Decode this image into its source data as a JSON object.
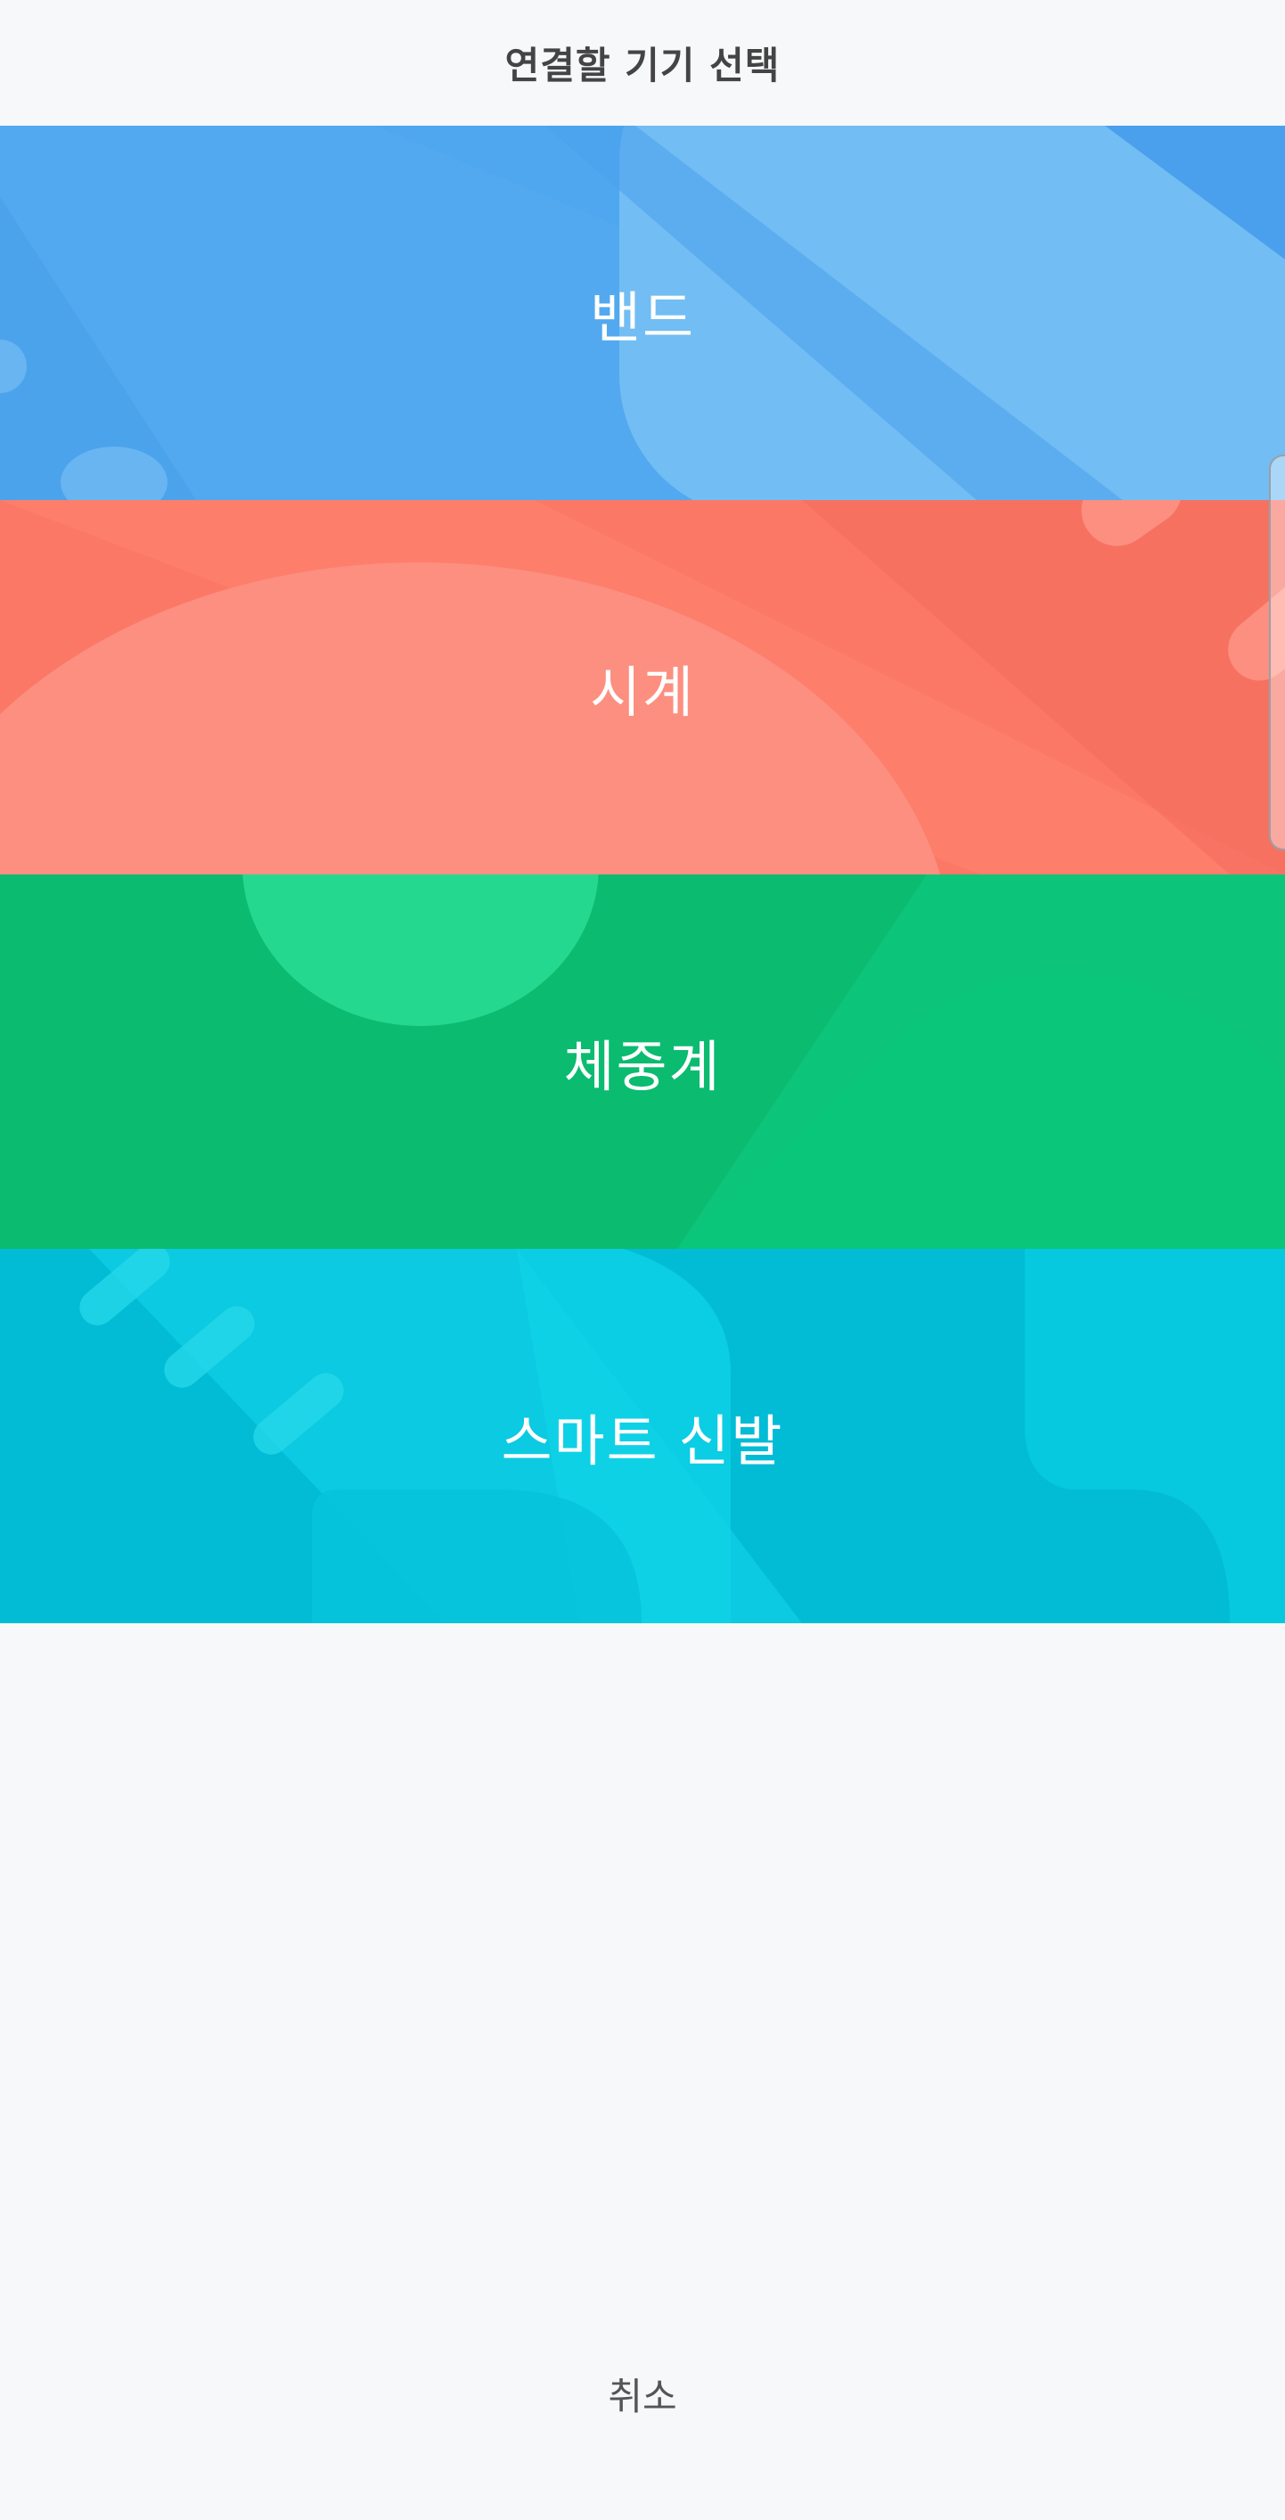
{
  "header": {
    "title": "연결할 기기 선택"
  },
  "devices": [
    {
      "label": "밴드",
      "color": "#4fa8ef"
    },
    {
      "label": "시계",
      "color": "#fb7867"
    },
    {
      "label": "체중계",
      "color": "#0cc57a"
    },
    {
      "label": "스마트 신발",
      "color": "#05bfd8"
    }
  ],
  "footer": {
    "cancel_label": "취소"
  }
}
